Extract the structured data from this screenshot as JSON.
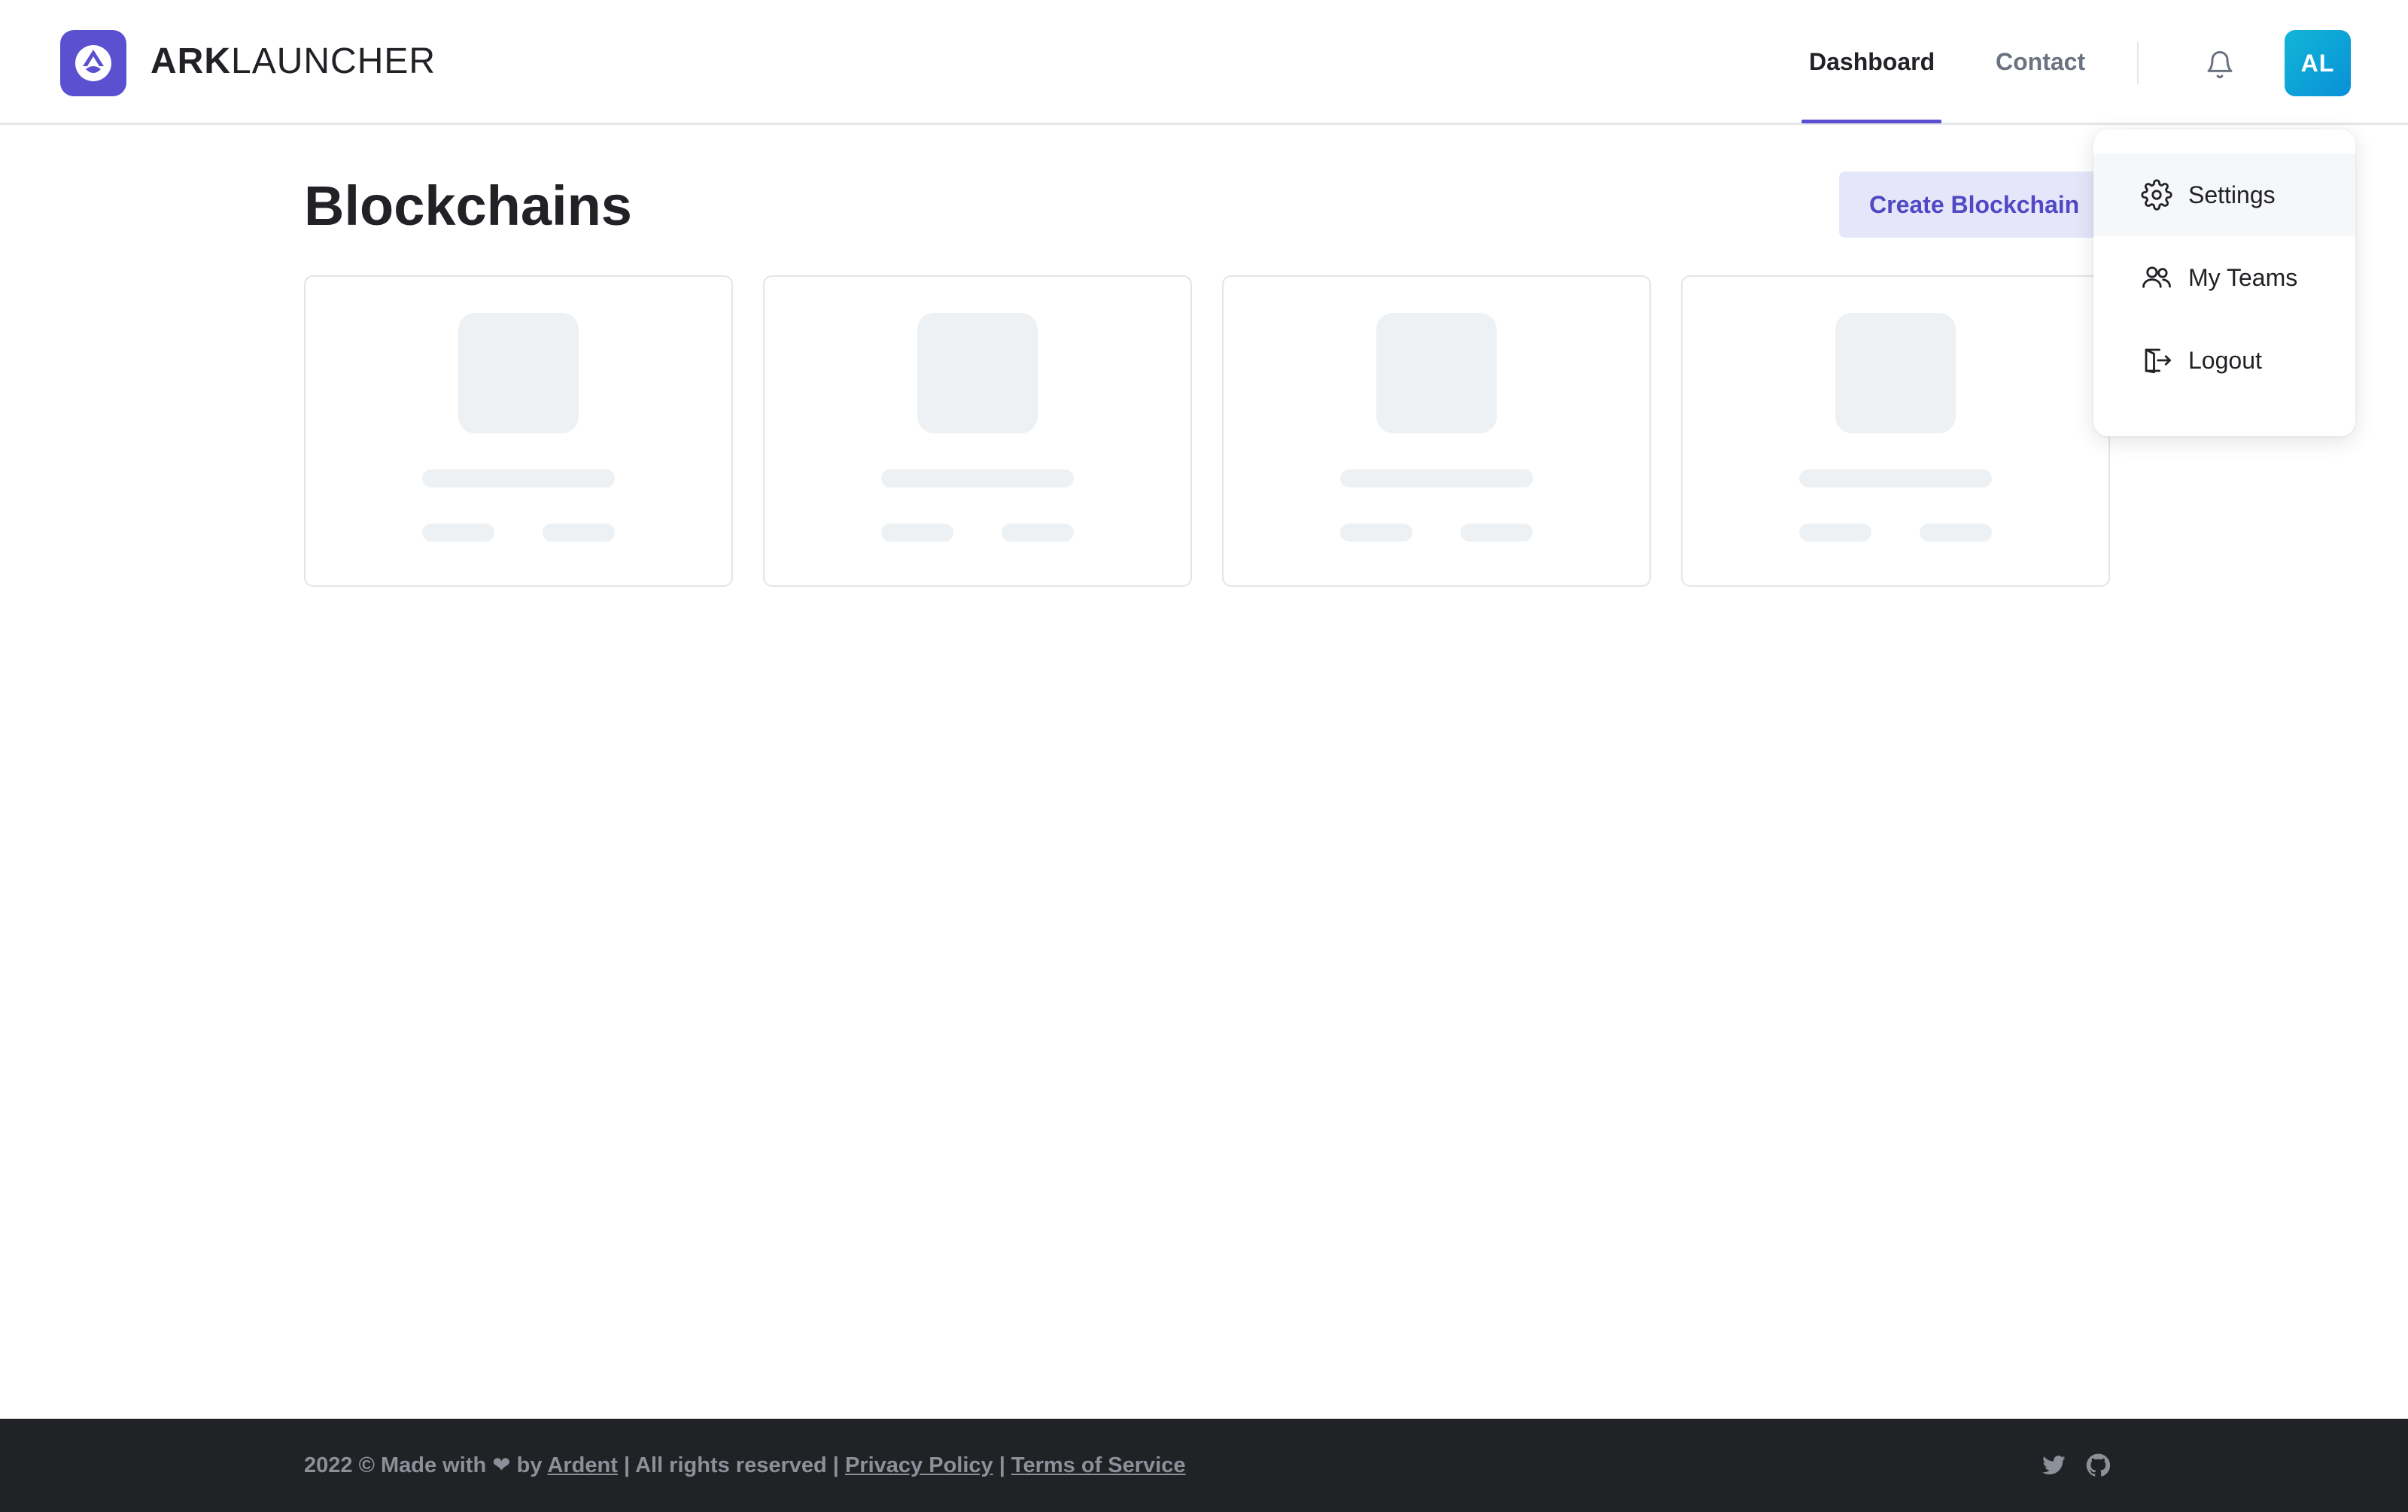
{
  "header": {
    "brand_bold": "ARK",
    "brand_light": "LAUNCHER",
    "logo_icon": "ark-logo-icon",
    "nav": {
      "dashboard": "Dashboard",
      "contact": "Contact",
      "active": "dashboard"
    },
    "notification_icon": "bell-icon",
    "avatar_initials": "AL"
  },
  "user_menu": {
    "items": [
      {
        "label": "Settings",
        "icon": "gear-icon",
        "highlighted": true
      },
      {
        "label": "My Teams",
        "icon": "users-icon",
        "highlighted": false
      },
      {
        "label": "Logout",
        "icon": "logout-icon",
        "highlighted": false
      }
    ]
  },
  "main": {
    "title": "Blockchains",
    "create_button": "Create Blockchain",
    "loading_cards": 4
  },
  "footer": {
    "prefix": "2022 © Made with",
    "heart": "❤",
    "by": "by",
    "author_link": "Ardent",
    "rights": "All rights reserved",
    "privacy_link": "Privacy Policy",
    "terms_link": "Terms of Service",
    "separator": "|",
    "social_icons": [
      "twitter-icon",
      "github-icon"
    ]
  },
  "colors": {
    "brand": "#5b51d0",
    "avatar_gradient_start": "#11b6d6",
    "avatar_gradient_end": "#0a90d8",
    "button_bg": "#e6e6fb",
    "button_text": "#5149c4",
    "footer_bg": "#212226",
    "skeleton": "#edf1f3"
  }
}
